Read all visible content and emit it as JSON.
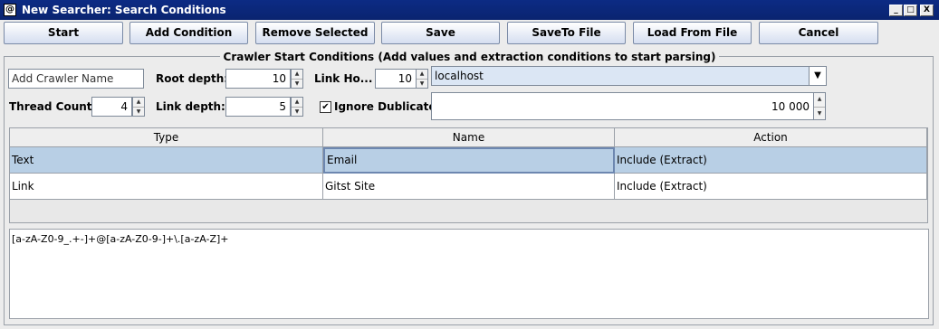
{
  "window": {
    "title": "New Searcher: Search Conditions",
    "app_icon": "@",
    "controls": [
      "_",
      "□",
      "X"
    ]
  },
  "toolbar": {
    "start": "Start",
    "add_condition": "Add Condition",
    "remove_selected": "Remove Selected",
    "save": "Save",
    "save_to_file": "SaveTo File",
    "load_from_file": "Load From File",
    "cancel": "Cancel"
  },
  "group": {
    "title": "Crawler Start Conditions (Add values and extraction conditions to start parsing)"
  },
  "form": {
    "crawler_name_value": "Add Crawler Name",
    "root_depth_label": "Root depth:",
    "root_depth_value": "10",
    "link_hosts_label": "Link Ho...",
    "link_hosts_value": "10",
    "host_combo_value": "localhost",
    "thread_count_label": "Thread Count:",
    "thread_count_value": "4",
    "link_depth_label": "Link depth:",
    "link_depth_value": "5",
    "ignore_duplicates_label": "Ignore Dublicates",
    "ignore_duplicates_checked": true,
    "limit_value": "10 000"
  },
  "table": {
    "columns": [
      "Type",
      "Name",
      "Action"
    ],
    "rows": [
      {
        "type": "Text",
        "name": "Email",
        "action": "Include (Extract)",
        "selected": true
      },
      {
        "type": "Link",
        "name": "Gitst Site",
        "action": "Include (Extract)",
        "selected": false
      }
    ]
  },
  "expression": {
    "value": "[a-zA-Z0-9_.+-]+@[a-zA-Z0-9-]+\\.[a-zA-Z]+"
  },
  "icons": {
    "check": "✔",
    "combo_arrow": "▼",
    "spin_up": "▲",
    "spin_down": "▼"
  }
}
